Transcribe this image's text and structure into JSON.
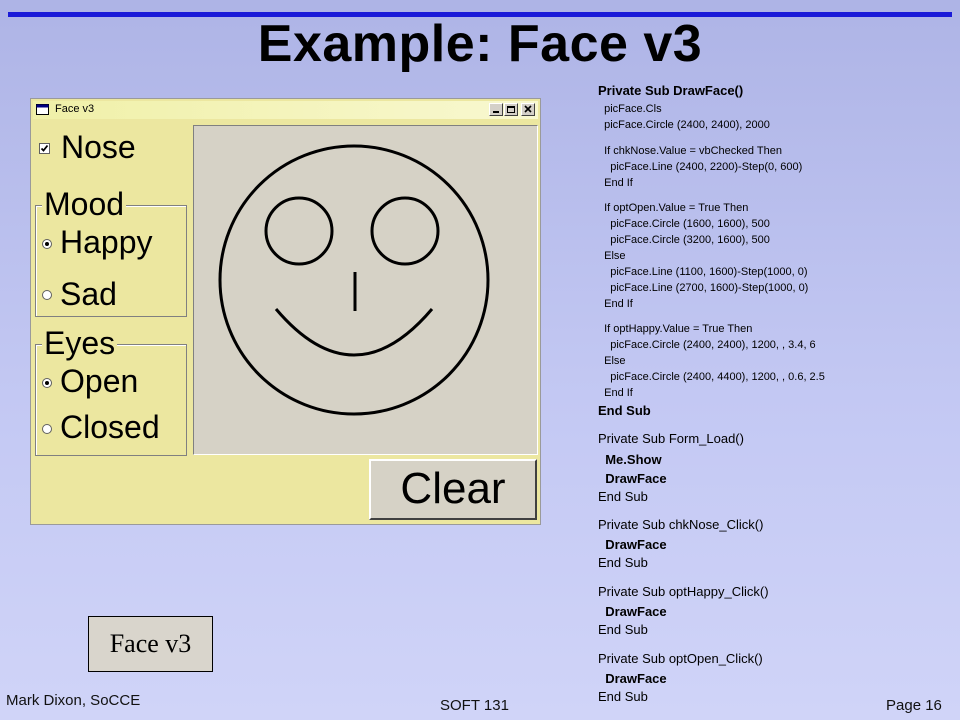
{
  "slide": {
    "title": "Example: Face v3",
    "author": "Mark Dixon, SoCCE",
    "course": "SOFT 131",
    "page": "Page 16",
    "label_box": "Face v3"
  },
  "window": {
    "title": "Face v3",
    "controls": [
      "minimize-icon",
      "maximize-icon",
      "close-icon"
    ],
    "nose_checkbox": {
      "label": "Nose",
      "checked": true
    },
    "mood_frame": {
      "title": "Mood",
      "options": [
        {
          "label": "Happy",
          "selected": true
        },
        {
          "label": "Sad",
          "selected": false
        }
      ]
    },
    "eyes_frame": {
      "title": "Eyes",
      "options": [
        {
          "label": "Open",
          "selected": true
        },
        {
          "label": "Closed",
          "selected": false
        }
      ]
    },
    "clear_button": "Clear"
  },
  "code": {
    "lines": [
      "Private Sub DrawFace()",
      "  picFace.Cls",
      "  picFace.Circle (2400, 2400), 2000",
      "  If chkNose.Value = vbChecked Then",
      "    picFace.Line (2400, 2200)-Step(0, 600)",
      "  End If",
      "  If optOpen.Value = True Then",
      "    picFace.Circle (1600, 1600), 500",
      "    picFace.Circle (3200, 1600), 500",
      "  Else",
      "    picFace.Line (1100, 1600)-Step(1000, 0)",
      "    picFace.Line (2700, 1600)-Step(1000, 0)",
      "  End If",
      "  If optHappy.Value = True Then",
      "    picFace.Circle (2400, 2400), 1200, , 3.4, 6",
      "  Else",
      "    picFace.Circle (2400, 4400), 1200, , 0.6, 2.5",
      "  End If",
      "End Sub",
      "Private Sub Form_Load()",
      "  Me.Show",
      "  DrawFace",
      "End Sub",
      "Private Sub chkNose_Click()",
      "  DrawFace",
      "End Sub",
      "Private Sub optHappy_Click()",
      "  DrawFace",
      "End Sub",
      "Private Sub optOpen_Click()",
      "  DrawFace",
      "End Sub"
    ]
  }
}
